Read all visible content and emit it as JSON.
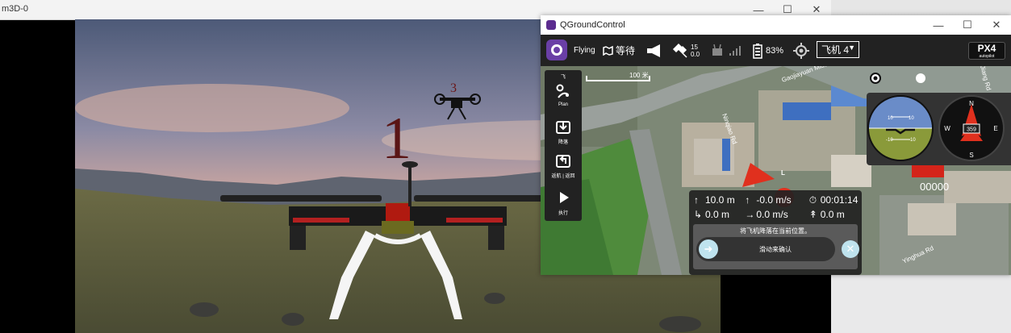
{
  "background_window": {
    "title": "m3D-0",
    "controls": {
      "minimize": "—",
      "maximize": "☐",
      "close": "✕"
    },
    "scene": {
      "label_1": "1",
      "label_3": "3"
    }
  },
  "qgc": {
    "window_title": "QGroundControl",
    "controls": {
      "minimize": "—",
      "maximize": "☐",
      "close": "✕"
    },
    "toolbar": {
      "flight_mode": "Flying",
      "flight_state": "等待",
      "gps_count": "15",
      "gps_hdop": "0.0",
      "battery": "83%",
      "vehicle": "飞机 4",
      "brand_main": "PX4",
      "brand_sub": "autopilot"
    },
    "tools": [
      {
        "label": "Plan",
        "icon": "plan-icon"
      },
      {
        "label": "降落",
        "icon": "land-icon"
      },
      {
        "label": "返航 | 返回",
        "icon": "rtl-icon"
      },
      {
        "label": "执行",
        "icon": "execute-icon"
      }
    ],
    "tool_top_label": "飞",
    "map": {
      "scale": "100 米",
      "streets": [
        "Gaojiayuan Middle St",
        "Ninqiao Rd",
        "Yinghua Rd",
        "Jiang Rd"
      ],
      "vehicle_marker": "L"
    },
    "telemetry": {
      "altitude": "10.0 m",
      "climb_rate": "-0.0 m/s",
      "flight_time": "00:01:14",
      "distance_home": "0.0 m",
      "ground_speed": "0.0 m/s",
      "dist_to_wp": "0.0 m"
    },
    "confirm": {
      "message": "将飞机降落在当前位置。",
      "slider_label": "滑动来确认"
    },
    "instruments": {
      "attitude_ticks": [
        "10",
        "10",
        "-10",
        "-10"
      ],
      "compass": {
        "n": "N",
        "e": "E",
        "s": "S",
        "w": "W",
        "heading": "359"
      },
      "counter": "00000"
    }
  },
  "colors": {
    "toolbar_bg": "#222222",
    "flying_green": "#ffffff",
    "accent": "#6a3fa6",
    "landing_marker": "#e0301e"
  }
}
